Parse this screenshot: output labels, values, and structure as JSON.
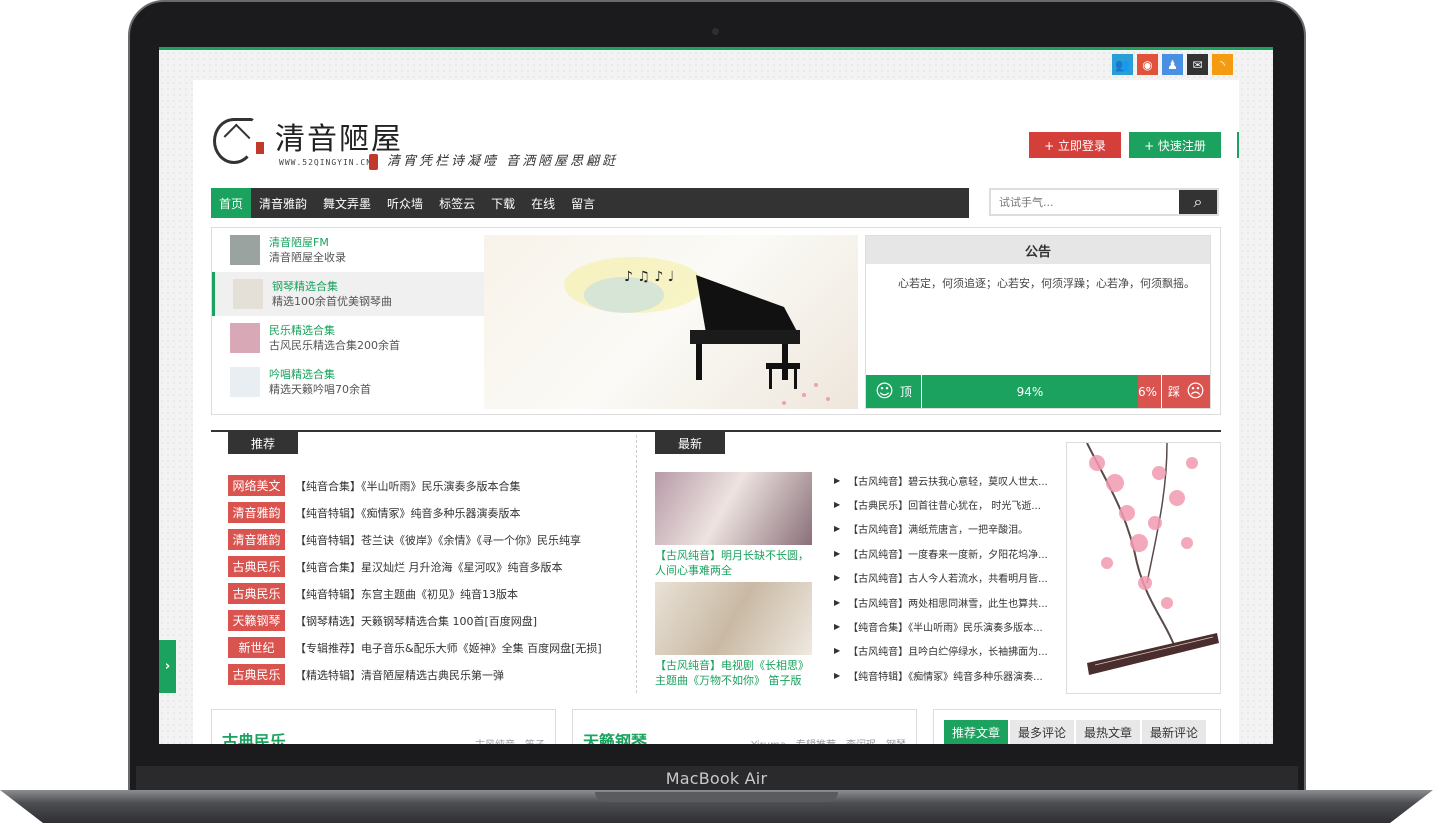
{
  "device": {
    "label": "MacBook Air"
  },
  "site": {
    "title": "清音陋屋",
    "url": "WWW.52QINGYIN.CN",
    "slogan": "清宵凭栏诗凝噎 音洒陋屋思翩跹",
    "login": "+ 立即登录",
    "register": "+ 快速注册"
  },
  "nav": {
    "items": [
      "首页",
      "清音雅韵",
      "舞文弄墨",
      "听众墙",
      "标签云",
      "下载",
      "在线",
      "留言"
    ],
    "active": "首页"
  },
  "search": {
    "placeholder": "试试手气..."
  },
  "albums": [
    {
      "title": "清音陋屋FM",
      "desc": "清音陋屋全收录"
    },
    {
      "title": "钢琴精选合集",
      "desc": "精选100余首优美钢琴曲"
    },
    {
      "title": "民乐精选合集",
      "desc": "古风民乐精选合集200余首"
    },
    {
      "title": "吟唱精选合集",
      "desc": "精选天籁吟唱70余首"
    }
  ],
  "notice": {
    "title": "公告",
    "text": "心若定，何须追逐；心若安，何须浮躁；心若净，何须飘摇。",
    "up_label": "顶",
    "up_percent": "94%",
    "down_label": "踩",
    "down_percent": "6%",
    "up_fraction": 0.94
  },
  "sections": {
    "recommend": "推荐",
    "latest": "最新"
  },
  "recommend": [
    {
      "tag": "网络美文",
      "title": "【纯音合集】《半山听雨》民乐演奏多版本合集"
    },
    {
      "tag": "清音雅韵",
      "title": "【纯音特辑】《痴情冢》纯音多种乐器演奏版本"
    },
    {
      "tag": "清音雅韵",
      "title": "【纯音特辑】苍兰诀《彼岸》《余情》《寻一个你》民乐纯享"
    },
    {
      "tag": "古典民乐",
      "title": "【纯音合集】星汉灿烂 月升沧海《星河叹》纯音多版本"
    },
    {
      "tag": "古典民乐",
      "title": "【纯音特辑】东宫主题曲《初见》纯音13版本"
    },
    {
      "tag": "天籁钢琴",
      "title": "【钢琴精选】天籁钢琴精选合集 100首[百度网盘]"
    },
    {
      "tag": "新世纪",
      "title": "【专辑推荐】电子音乐&配乐大师《姬神》全集 百度网盘[无损]"
    },
    {
      "tag": "古典民乐",
      "title": "【精选特辑】清音陋屋精选古典民乐第一弹"
    }
  ],
  "latest_captions": [
    "【古风纯音】明月长缺不长圆，人间心事难两全",
    "【古风纯音】电视剧《长相思》主题曲《万物不如你》 笛子版"
  ],
  "latest_list": [
    "【古风纯音】碧云扶我心意轻，莫叹人世太...",
    "【古典民乐】回首往昔心犹在， 时光飞逝...",
    "【古风纯音】满纸荒唐言，一把辛酸泪。",
    "【古风纯音】一度春来一度新，夕阳花坞净...",
    "【古风纯音】古人今人若流水，共看明月皆...",
    "【古风纯音】两处相思同淋雪，此生也算共...",
    "【纯音合集】《半山听雨》民乐演奏多版本...",
    "【古风纯音】且吟白纻停绿水，长袖拂面为...",
    "【纯音特辑】《痴情冢》纯音多种乐器演奏..."
  ],
  "cards": [
    {
      "title": "古典民乐",
      "tags": "古风纯音，笛子"
    },
    {
      "title": "天籁钢琴",
      "tags": "Yiruma，专辑推荐，李闰珉，钢琴"
    }
  ],
  "tabs": [
    "推荐文章",
    "最多评论",
    "最热文章",
    "最新评论"
  ],
  "colors": {
    "accent": "#1aa25e",
    "danger": "#d9534f",
    "dark": "#333333"
  }
}
